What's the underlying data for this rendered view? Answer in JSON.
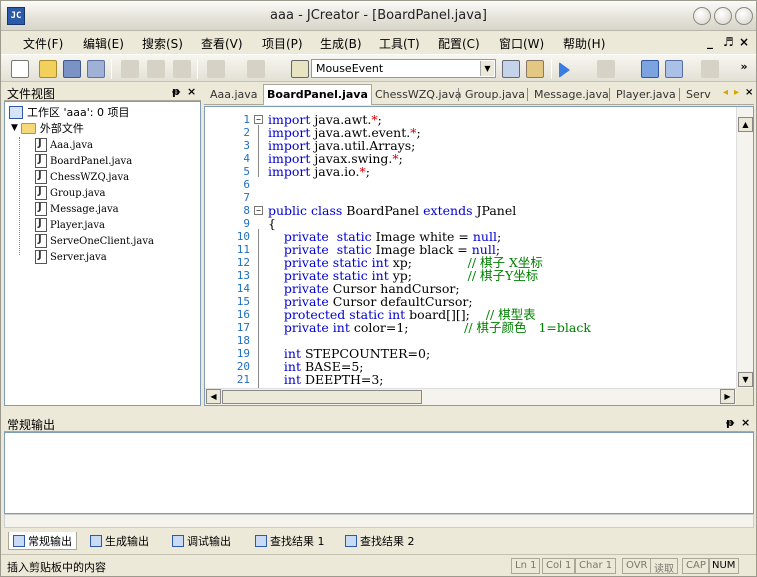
{
  "window": {
    "title": "aaa - JCreator - [BoardPanel.java]",
    "app_icon_label": "JC"
  },
  "menu": {
    "items": [
      "文件(F)",
      "编辑(E)",
      "搜索(S)",
      "查看(V)",
      "项目(P)",
      "生成(B)",
      "工具(T)",
      "配置(C)",
      "窗口(W)",
      "帮助(H)"
    ],
    "mdi_min": "_",
    "mdi_restore": "♬",
    "mdi_close": "×"
  },
  "toolbar": {
    "search_value": "MouseEvent"
  },
  "file_view": {
    "title": "文件视图",
    "pin": "ᵽ",
    "close": "×",
    "workspace": "工作区 'aaa': 0 项目",
    "folder": "外部文件",
    "files": [
      "Aaa.java",
      "BoardPanel.java",
      "ChessWZQ.java",
      "Group.java",
      "Message.java",
      "Player.java",
      "ServeOneClient.java",
      "Server.java"
    ]
  },
  "tabs": {
    "items": [
      "Aaa.java",
      "BoardPanel.java",
      "ChessWZQ.java",
      "Group.java",
      "Message.java",
      "Player.java",
      "Serv"
    ],
    "active": "BoardPanel.java",
    "nav_left": "◂",
    "nav_right": "▸",
    "close": "×"
  },
  "editor": {
    "line_numbers": [
      "1",
      "2",
      "3",
      "4",
      "5",
      "6",
      "7",
      "8",
      "9",
      "10",
      "11",
      "12",
      "13",
      "14",
      "15",
      "16",
      "17",
      "18",
      "19",
      "20",
      "21"
    ]
  },
  "output": {
    "title": "常规输出",
    "pin": "ᵽ",
    "close": "×",
    "tabs": [
      "常规输出",
      "生成输出",
      "调试输出",
      "查找结果 1",
      "查找结果 2"
    ]
  },
  "status": {
    "message": "插入剪贴板中的内容",
    "ln": "Ln 1",
    "col": "Col 1",
    "char": "Char 1",
    "ovr": "OVR",
    "read": "读取",
    "cap": "CAP",
    "num": "NUM"
  }
}
